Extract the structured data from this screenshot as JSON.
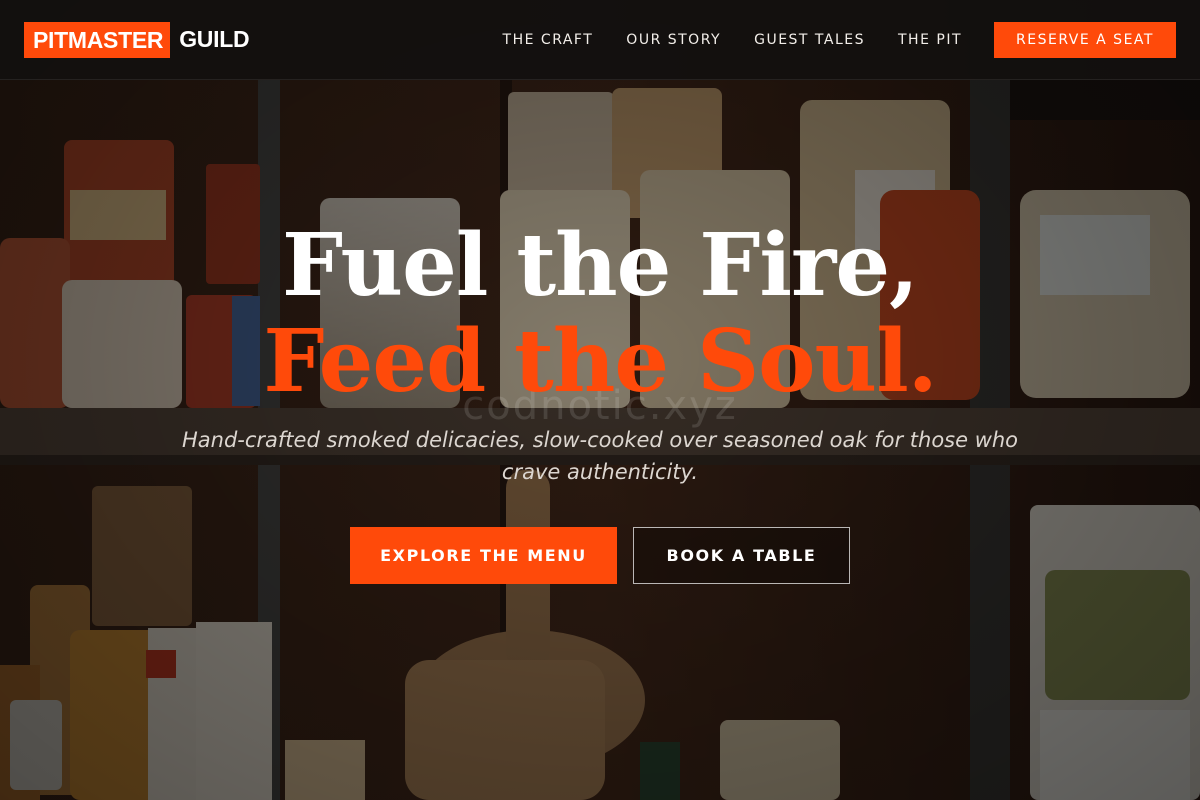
{
  "brand": {
    "logo_mark": "PITMASTER",
    "logo_rest": "GUILD",
    "accent_color": "#ff4a0a"
  },
  "nav": {
    "links": [
      "THE CRAFT",
      "OUR STORY",
      "GUEST TALES",
      "THE PIT"
    ],
    "cta_label": "RESERVE A SEAT"
  },
  "hero": {
    "headline_line1": "Fuel the Fire,",
    "headline_line2": "Feed the Soul.",
    "watermark": "codnotic.xyz",
    "subcopy": "Hand-crafted smoked delicacies, slow-cooked over seasoned oak for those who crave authenticity.",
    "primary_cta": "EXPLORE THE MENU",
    "secondary_cta": "BOOK A TABLE",
    "background_image": "pantry-shelves-with-pasta-bags-photo"
  }
}
